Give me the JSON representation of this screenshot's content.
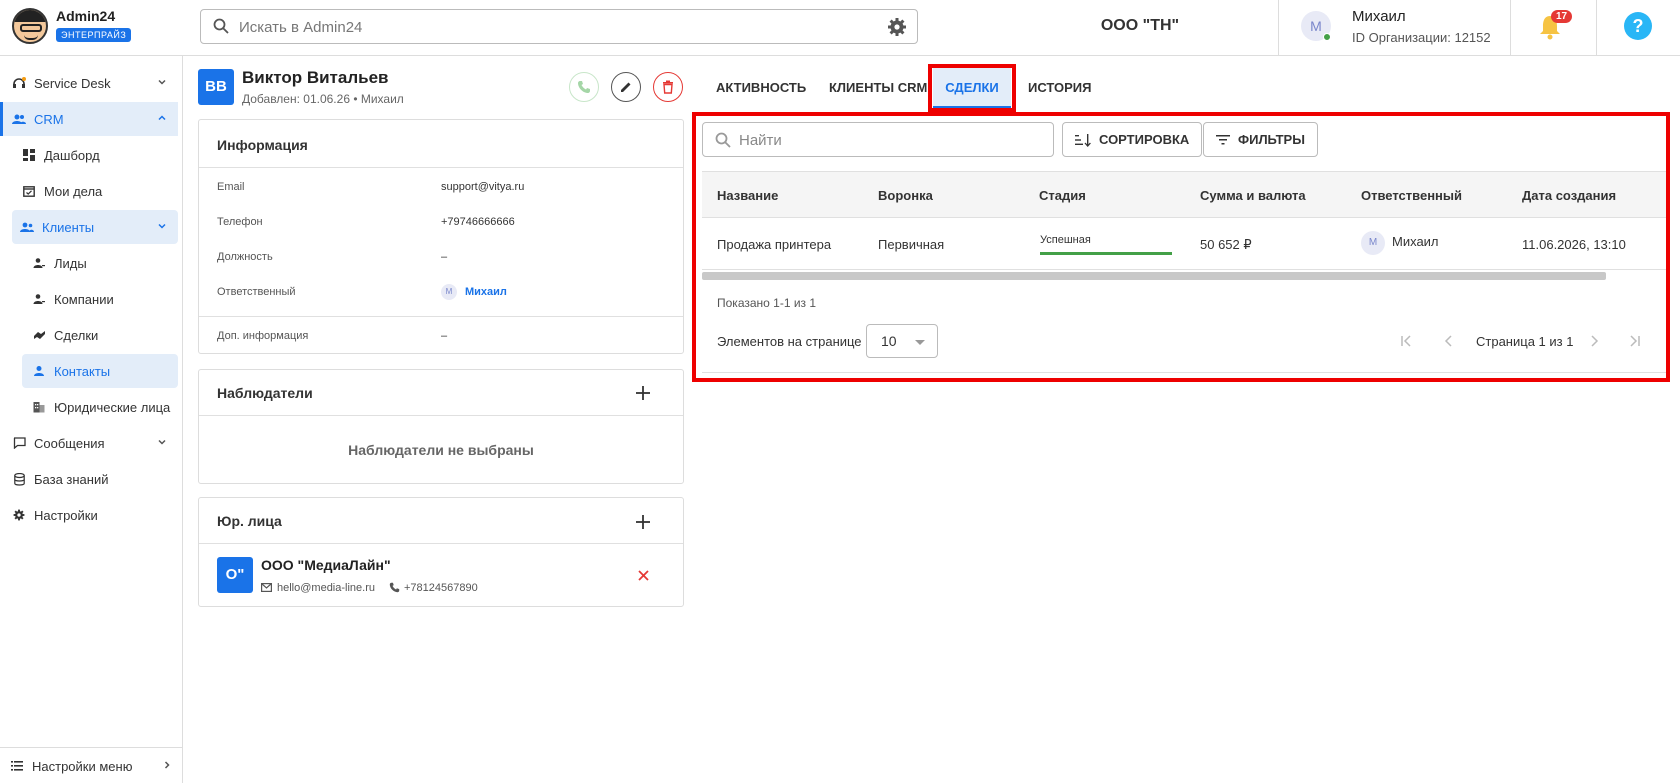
{
  "app": {
    "brand": "Admin24",
    "plan_badge": "ЭНТЕРПРАЙЗ"
  },
  "search": {
    "placeholder": "Искать в Admin24"
  },
  "org_name": "ООО \"ТН\"",
  "user": {
    "initial": "М",
    "name": "Михаил",
    "org_id": "ID Организации: 12152"
  },
  "notifications": {
    "count": "17"
  },
  "help_label": "?",
  "colors": {
    "accent": "#1a73e8",
    "active_bg": "#e3edf9",
    "success": "#43a047",
    "highlight": "#e00000",
    "danger": "#e53935"
  },
  "sidebar": {
    "items": [
      {
        "label": "Service Desk",
        "icon": "headset-icon"
      },
      {
        "label": "CRM",
        "icon": "people-icon"
      },
      {
        "label": "Дашборд",
        "icon": "dashboard-icon"
      },
      {
        "label": "Мои дела",
        "icon": "calendar-check-icon"
      },
      {
        "label": "Клиенты",
        "icon": "group-icon"
      },
      {
        "label": "Лиды",
        "icon": "person-add-icon"
      },
      {
        "label": "Компании",
        "icon": "person-add-icon"
      },
      {
        "label": "Сделки",
        "icon": "handshake-icon"
      },
      {
        "label": "Контакты",
        "icon": "person-icon"
      },
      {
        "label": "Юридические лица",
        "icon": "building-icon"
      },
      {
        "label": "Сообщения",
        "icon": "chat-icon"
      },
      {
        "label": "База знаний",
        "icon": "database-icon"
      },
      {
        "label": "Настройки",
        "icon": "gear-icon"
      }
    ],
    "footer": "Настройки меню"
  },
  "contact": {
    "initials": "ВВ",
    "name": "Виктор Витальев",
    "added": "Добавлен: 01.06.26 • Михаил"
  },
  "info_card": {
    "title": "Информация",
    "rows": [
      {
        "label": "Email",
        "value": "support@vitya.ru"
      },
      {
        "label": "Телефон",
        "value": "+79746666666"
      },
      {
        "label": "Должность",
        "value": "–"
      },
      {
        "label": "Ответственный",
        "value": "Михаил",
        "avatar": "М"
      },
      {
        "label": "Доп. информация",
        "value": "–"
      }
    ]
  },
  "observers_card": {
    "title": "Наблюдатели",
    "empty": "Наблюдатели не выбраны"
  },
  "legal_card": {
    "title": "Юр. лица",
    "item": {
      "initials": "О\"",
      "name": "ООО \"МедиаЛайн\"",
      "email": "hello@media-line.ru",
      "phone": "+78124567890"
    }
  },
  "tabs": [
    {
      "label": "АКТИВНОСТЬ"
    },
    {
      "label": "КЛИЕНТЫ CRM"
    },
    {
      "label": "СДЕЛКИ"
    },
    {
      "label": "ИСТОРИЯ"
    }
  ],
  "deals": {
    "search_placeholder": "Найти",
    "sort_label": "СОРТИРОВКА",
    "filter_label": "ФИЛЬТРЫ",
    "columns": [
      "Название",
      "Воронка",
      "Стадия",
      "Сумма и валюта",
      "Ответственный",
      "Дата создания"
    ],
    "rows": [
      {
        "name": "Продажа принтера",
        "funnel": "Первичная",
        "stage": "Успешная",
        "amount": "50 652 ₽",
        "owner": "Михаил",
        "owner_initial": "М",
        "created": "11.06.2026, 13:10"
      }
    ],
    "shown": "Показано 1-1 из 1",
    "per_page_label": "Элементов на странице",
    "per_page_value": "10",
    "page_text": "Страница 1 из 1"
  }
}
